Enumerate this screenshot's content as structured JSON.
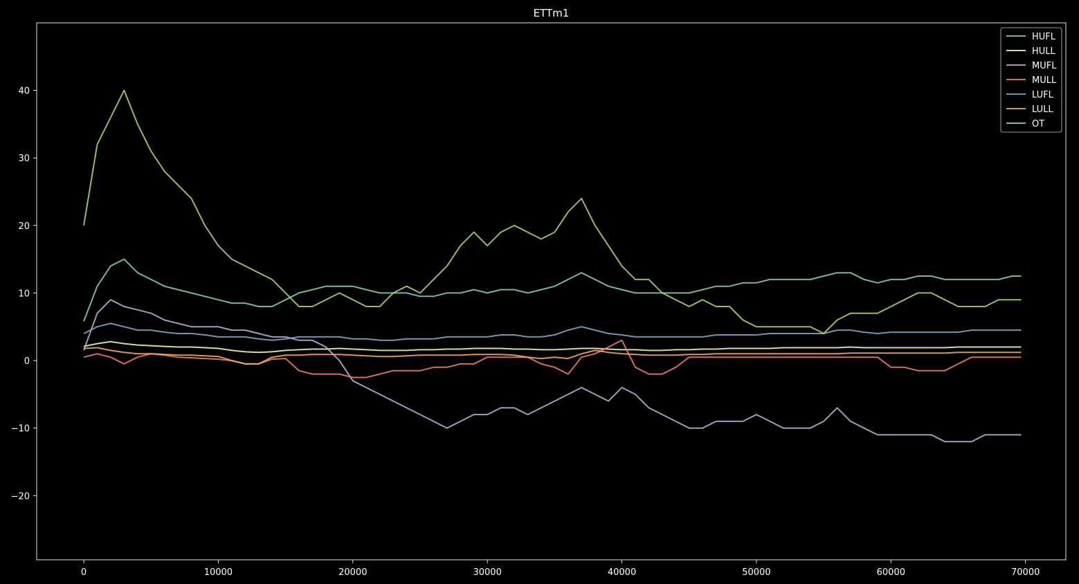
{
  "chart_data": {
    "type": "line",
    "title": "ETTm1",
    "xlabel": "",
    "ylabel": "",
    "xlim": [
      -3500,
      73000
    ],
    "ylim": [
      -29.5,
      50
    ],
    "x_ticks": [
      0,
      10000,
      20000,
      30000,
      40000,
      50000,
      60000,
      70000
    ],
    "x_tick_labels": [
      "0",
      "10000",
      "20000",
      "30000",
      "40000",
      "50000",
      "60000",
      "70000"
    ],
    "y_ticks": [
      -20,
      -10,
      0,
      10,
      20,
      30,
      40
    ],
    "y_tick_labels": [
      "−20",
      "−10",
      "0",
      "10",
      "20",
      "30",
      "40"
    ],
    "grid": false,
    "legend_position": "top-right",
    "background": "#000000",
    "x": [
      0,
      1000,
      2000,
      3000,
      4000,
      5000,
      6000,
      7000,
      8000,
      9000,
      10000,
      11000,
      12000,
      13000,
      14000,
      15000,
      16000,
      17000,
      18000,
      19000,
      20000,
      21000,
      22000,
      23000,
      24000,
      25000,
      26000,
      27000,
      28000,
      29000,
      30000,
      31000,
      32000,
      33000,
      34000,
      35000,
      36000,
      37000,
      38000,
      39000,
      40000,
      41000,
      42000,
      43000,
      44000,
      45000,
      46000,
      47000,
      48000,
      49000,
      50000,
      51000,
      52000,
      53000,
      54000,
      55000,
      56000,
      57000,
      58000,
      59000,
      60000,
      61000,
      62000,
      63000,
      64000,
      65000,
      66000,
      67000,
      68000,
      69000,
      69680
    ],
    "series": [
      {
        "name": "HUFL",
        "color": "#8dd3c7",
        "values": [
          5.8,
          11,
          14,
          15,
          13,
          12,
          11,
          10.5,
          10,
          9.5,
          9,
          8.5,
          8.5,
          8,
          8,
          9,
          10,
          10.5,
          11,
          11,
          11,
          10.5,
          10,
          10,
          10,
          9.5,
          9.5,
          10,
          10,
          10.5,
          10,
          10.5,
          10.5,
          10,
          10.5,
          11,
          12,
          13,
          12,
          11,
          10.5,
          10,
          10,
          10,
          10,
          10,
          10.5,
          11,
          11,
          11.5,
          11.5,
          12,
          12,
          12,
          12,
          12.5,
          13,
          13,
          12,
          11.5,
          12,
          12,
          12.5,
          12.5,
          12,
          12,
          12,
          12,
          12,
          12.5,
          12.5
        ]
      },
      {
        "name": "HULL",
        "color": "#ffffb3",
        "values": [
          2.1,
          2.5,
          2.8,
          2.5,
          2.3,
          2.2,
          2.1,
          2.0,
          2.0,
          1.9,
          1.8,
          1.5,
          1.3,
          1.2,
          1.3,
          1.5,
          1.6,
          1.7,
          1.7,
          1.8,
          1.7,
          1.6,
          1.5,
          1.5,
          1.5,
          1.6,
          1.6,
          1.7,
          1.7,
          1.8,
          1.8,
          1.8,
          1.7,
          1.7,
          1.6,
          1.6,
          1.7,
          1.8,
          1.8,
          1.7,
          1.6,
          1.6,
          1.5,
          1.5,
          1.6,
          1.6,
          1.7,
          1.7,
          1.8,
          1.8,
          1.8,
          1.8,
          1.9,
          1.9,
          1.9,
          1.9,
          1.9,
          2.0,
          1.9,
          1.9,
          1.9,
          1.9,
          1.9,
          1.9,
          1.9,
          2.0,
          2.0,
          2.0,
          2.0,
          2.0,
          2.0
        ]
      },
      {
        "name": "MUFL",
        "color": "#bebada",
        "values": [
          1.5,
          7,
          9,
          8,
          7.5,
          7,
          6,
          5.5,
          5,
          5,
          5,
          4.5,
          4.5,
          4,
          3.5,
          3.5,
          3,
          3,
          2,
          0,
          -3,
          -4,
          -5,
          -6,
          -7,
          -8,
          -9,
          -10,
          -9,
          -8,
          -8,
          -7,
          -7,
          -8,
          -7,
          -6,
          -5,
          -4,
          -5,
          -6,
          -4,
          -5,
          -7,
          -8,
          -9,
          -10,
          -10,
          -9,
          -9,
          -9,
          -8,
          -9,
          -10,
          -10,
          -10,
          -9,
          -7,
          -9,
          -10,
          -11,
          -11,
          -11,
          -11,
          -11,
          -12,
          -12,
          -12,
          -11,
          -11,
          -11,
          -11
        ]
      },
      {
        "name": "MULL",
        "color": "#fb8072",
        "values": [
          0.5,
          1.0,
          0.5,
          -0.5,
          0.5,
          1.0,
          0.8,
          0.5,
          0.4,
          0.3,
          0.2,
          0.0,
          -0.5,
          -0.5,
          0.2,
          0.3,
          -1.5,
          -2.0,
          -2.0,
          -2.0,
          -2.5,
          -2.5,
          -2.0,
          -1.5,
          -1.5,
          -1.5,
          -1.0,
          -1.0,
          -0.5,
          -0.5,
          0.5,
          0.5,
          0.5,
          0.5,
          -0.5,
          -1.0,
          -2.0,
          0.5,
          1.0,
          2.0,
          3.0,
          -1.0,
          -2.0,
          -2.0,
          -1.0,
          0.5,
          0.5,
          0.5,
          0.5,
          0.5,
          0.5,
          0.5,
          0.5,
          0.5,
          0.5,
          0.5,
          0.5,
          0.5,
          0.5,
          0.5,
          -1.0,
          -1.0,
          -1.5,
          -1.5,
          -1.5,
          -0.5,
          0.5,
          0.5,
          0.5,
          0.5,
          0.5
        ]
      },
      {
        "name": "LUFL",
        "color": "#80b1d3",
        "values": [
          4.0,
          5.0,
          5.5,
          5.0,
          4.5,
          4.5,
          4.2,
          4.0,
          4.0,
          3.8,
          3.5,
          3.5,
          3.5,
          3.2,
          3.0,
          3.2,
          3.5,
          3.5,
          3.5,
          3.5,
          3.2,
          3.2,
          3.0,
          3.0,
          3.2,
          3.2,
          3.2,
          3.5,
          3.5,
          3.5,
          3.5,
          3.8,
          3.8,
          3.5,
          3.5,
          3.8,
          4.5,
          5.0,
          4.5,
          4.0,
          3.8,
          3.5,
          3.5,
          3.5,
          3.5,
          3.5,
          3.5,
          3.8,
          3.8,
          3.8,
          3.8,
          4.0,
          4.0,
          4.0,
          4.0,
          4.0,
          4.5,
          4.5,
          4.2,
          4.0,
          4.2,
          4.2,
          4.2,
          4.2,
          4.2,
          4.2,
          4.5,
          4.5,
          4.5,
          4.5,
          4.5
        ]
      },
      {
        "name": "LULL",
        "color": "#fdb462",
        "values": [
          1.8,
          1.9,
          1.5,
          1.2,
          1.0,
          1.0,
          0.9,
          0.8,
          0.8,
          0.7,
          0.6,
          0.0,
          -0.5,
          -0.5,
          0.5,
          0.8,
          0.8,
          0.9,
          0.9,
          0.9,
          0.8,
          0.7,
          0.6,
          0.6,
          0.7,
          0.8,
          0.8,
          0.8,
          0.8,
          0.9,
          0.9,
          0.9,
          0.8,
          0.5,
          0.3,
          0.5,
          0.3,
          1.0,
          1.5,
          1.2,
          1.0,
          0.9,
          0.8,
          0.8,
          0.8,
          0.9,
          0.9,
          1.0,
          1.0,
          1.0,
          1.0,
          1.0,
          1.0,
          1.0,
          1.0,
          1.0,
          1.0,
          1.1,
          1.1,
          1.1,
          1.1,
          1.1,
          1.1,
          1.1,
          1.1,
          1.2,
          1.2,
          1.2,
          1.2,
          1.2,
          1.2
        ]
      },
      {
        "name": "OT",
        "color": "#b3de69",
        "values": [
          20,
          32,
          36,
          40,
          35,
          31,
          28,
          26,
          24,
          20,
          17,
          15,
          14,
          13,
          12,
          10,
          8,
          8,
          9,
          10,
          9,
          8,
          8,
          10,
          11,
          10,
          12,
          14,
          17,
          19,
          17,
          19,
          20,
          19,
          18,
          19,
          22,
          24,
          20,
          17,
          14,
          12,
          12,
          10,
          9,
          8,
          9,
          8,
          8,
          6,
          5,
          5,
          5,
          5,
          5,
          4,
          6,
          7,
          7,
          7,
          8,
          9,
          10,
          10,
          9,
          8,
          8,
          8,
          9,
          9,
          9
        ]
      }
    ]
  }
}
